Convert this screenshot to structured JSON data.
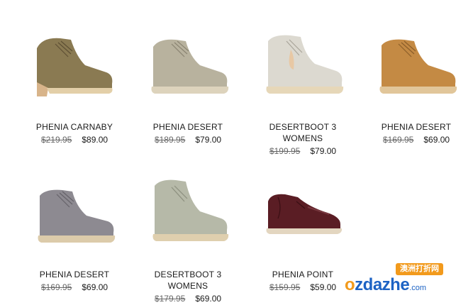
{
  "products": [
    {
      "name": "PHENIA CARNABY",
      "old_price": "$219.95",
      "new_price": "$89.00",
      "color": "#8a7a52",
      "style": "heeled"
    },
    {
      "name": "PHENIA DESERT",
      "old_price": "$189.95",
      "new_price": "$79.00",
      "color": "#b8b29e",
      "style": "chukka"
    },
    {
      "name": "DESERTBOOT 3 WOMENS",
      "old_price": "$199.95",
      "new_price": "$79.00",
      "color": "#dcd9d0",
      "style": "chukka"
    },
    {
      "name": "PHENIA DESERT",
      "old_price": "$169.95",
      "new_price": "$69.00",
      "color": "#c48a44",
      "style": "chukka"
    },
    {
      "name": "PHENIA DESERT",
      "old_price": "$169.95",
      "new_price": "$69.00",
      "color": "#8d8a91",
      "style": "chukka"
    },
    {
      "name": "DESERTBOOT 3 WOMENS",
      "old_price": "$179.95",
      "new_price": "$69.00",
      "color": "#b6b9a8",
      "style": "chukka"
    },
    {
      "name": "PHENIA POINT",
      "old_price": "$159.95",
      "new_price": "$59.00",
      "color": "#5a1d24",
      "style": "oxford"
    }
  ],
  "watermark": {
    "badge": "澳洲打折网",
    "logo_o": "o",
    "logo_rest": "zdazhe",
    "domain": ".com"
  }
}
